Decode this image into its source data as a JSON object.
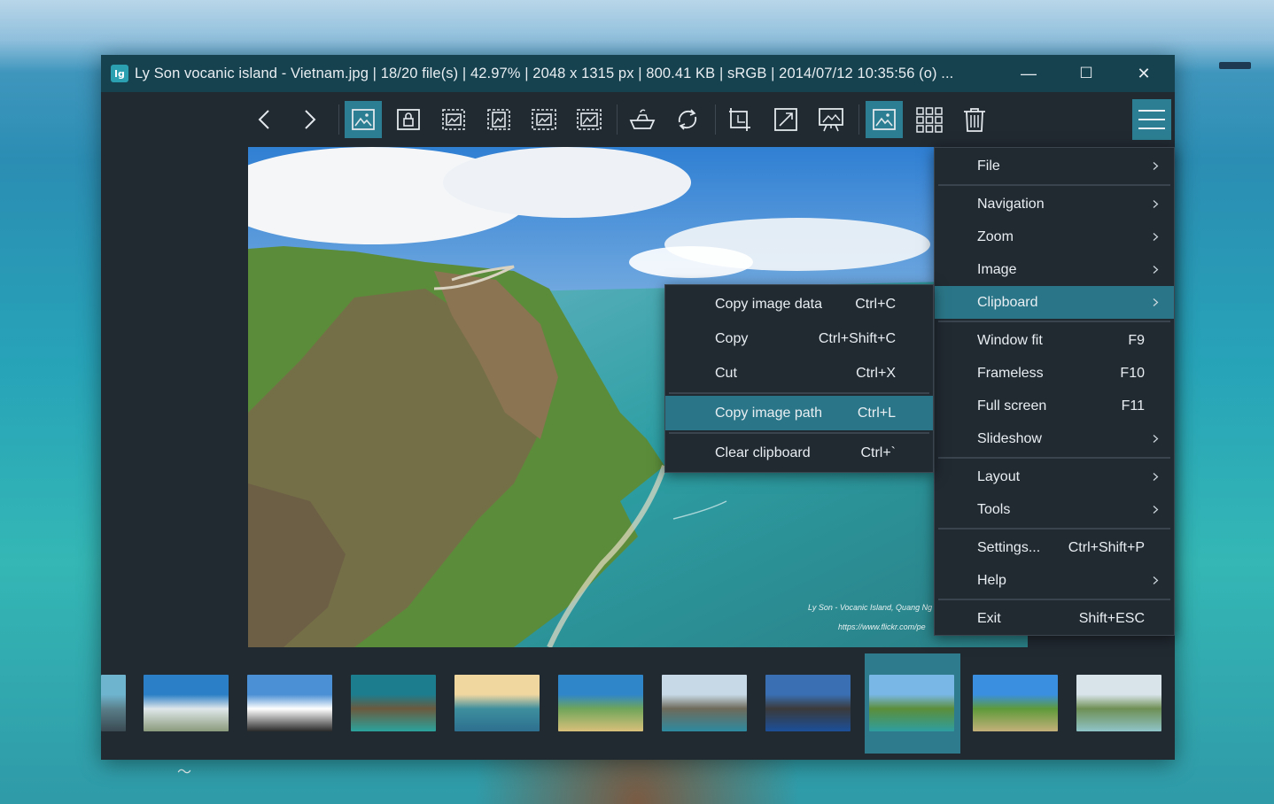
{
  "window": {
    "title": "Ly Son vocanic island - Vietnam.jpg  |  18/20 file(s)  |  42.97%  |  2048 x 1315 px  |  800.41 KB  |  sRGB  |  2014/07/12 10:35:56 (o) ...",
    "app_icon_text": "lg",
    "minimize_glyph": "—",
    "maximize_glyph": "☐",
    "close_glyph": "✕"
  },
  "toolbar": {
    "buttons": [
      {
        "name": "previous-image",
        "icon": "chevron-left-icon"
      },
      {
        "name": "next-image",
        "icon": "chevron-right-icon"
      },
      {
        "name": "auto-zoom",
        "icon": "image-frame-icon",
        "active": true
      },
      {
        "name": "lock-zoom",
        "icon": "image-lock-icon"
      },
      {
        "name": "scale-to-width",
        "icon": "scale-width-icon"
      },
      {
        "name": "scale-to-height",
        "icon": "scale-height-icon"
      },
      {
        "name": "scale-to-fit",
        "icon": "scale-fit-icon"
      },
      {
        "name": "scale-to-fill",
        "icon": "scale-fill-icon"
      },
      {
        "name": "open-with",
        "icon": "boat-icon"
      },
      {
        "name": "rotate",
        "icon": "rotate-icon"
      },
      {
        "name": "crop",
        "icon": "crop-icon"
      },
      {
        "name": "fullscreen",
        "icon": "expand-icon"
      },
      {
        "name": "slideshow",
        "icon": "presentation-icon"
      },
      {
        "name": "toggle-thumbnails",
        "icon": "image-frame-icon",
        "active": true
      },
      {
        "name": "gallery",
        "icon": "grid-icon"
      },
      {
        "name": "delete",
        "icon": "trash-icon"
      }
    ],
    "menu_icon": "hamburger-icon"
  },
  "viewer": {
    "credit_line1": "Ly Son - Vocanic Island, Quang Ng",
    "credit_line2": "https://www.flickr.com/pe"
  },
  "main_menu": {
    "items": [
      {
        "label": "File",
        "shortcut": "",
        "submenu": true
      },
      {
        "separator": true
      },
      {
        "label": "Navigation",
        "shortcut": "",
        "submenu": true
      },
      {
        "label": "Zoom",
        "shortcut": "",
        "submenu": true
      },
      {
        "label": "Image",
        "shortcut": "",
        "submenu": true
      },
      {
        "label": "Clipboard",
        "shortcut": "",
        "submenu": true,
        "highlighted": true
      },
      {
        "separator": true
      },
      {
        "label": "Window fit",
        "shortcut": "F9"
      },
      {
        "label": "Frameless",
        "shortcut": "F10"
      },
      {
        "label": "Full screen",
        "shortcut": "F11"
      },
      {
        "label": "Slideshow",
        "shortcut": "",
        "submenu": true
      },
      {
        "separator": true
      },
      {
        "label": "Layout",
        "shortcut": "",
        "submenu": true
      },
      {
        "label": "Tools",
        "shortcut": "",
        "submenu": true
      },
      {
        "separator": true
      },
      {
        "label": "Settings...",
        "shortcut": "Ctrl+Shift+P"
      },
      {
        "label": "Help",
        "shortcut": "",
        "submenu": true
      },
      {
        "separator": true
      },
      {
        "label": "Exit",
        "shortcut": "Shift+ESC"
      }
    ]
  },
  "clipboard_menu": {
    "items": [
      {
        "label": "Copy image data",
        "shortcut": "Ctrl+C"
      },
      {
        "label": "Copy",
        "shortcut": "Ctrl+Shift+C"
      },
      {
        "label": "Cut",
        "shortcut": "Ctrl+X"
      },
      {
        "separator": true
      },
      {
        "label": "Copy image path",
        "shortcut": "Ctrl+L",
        "highlighted": true
      },
      {
        "separator": true
      },
      {
        "label": "Clear clipboard",
        "shortcut": "Ctrl+`"
      }
    ]
  },
  "filmstrip": {
    "selected_index": 8,
    "thumbnails": [
      {
        "colors": [
          "#6fb4cf",
          "#5a7f8a",
          "#3a4a52"
        ]
      },
      {
        "colors": [
          "#2b7fc6",
          "#dfe7ea",
          "#8a9a7c"
        ]
      },
      {
        "colors": [
          "#4b8fd4",
          "#ffffff",
          "#2a2a2a"
        ]
      },
      {
        "colors": [
          "#1c7d8e",
          "#6b5a3e",
          "#2aa39d"
        ]
      },
      {
        "colors": [
          "#f0d7a0",
          "#3e8f9e",
          "#2d6f8f"
        ]
      },
      {
        "colors": [
          "#2f86c9",
          "#6fa55a",
          "#d9c07a"
        ]
      },
      {
        "colors": [
          "#c7d9e7",
          "#6e6a5a",
          "#2d8aa0"
        ]
      },
      {
        "colors": [
          "#3a6fb3",
          "#3b3a3a",
          "#1b4f9a"
        ]
      },
      {
        "colors": [
          "#79b7e6",
          "#5c8e3a",
          "#2e9ea0"
        ]
      },
      {
        "colors": [
          "#3a8fe0",
          "#5e9a3a",
          "#c4b07a"
        ]
      },
      {
        "colors": [
          "#d8e4ea",
          "#6e8f54",
          "#8fc4c8"
        ]
      }
    ]
  },
  "colors": {
    "accent": "#2c7f92",
    "titlebar": "#16414f",
    "window_bg": "#212931",
    "menu_highlight": "#2a7688"
  }
}
